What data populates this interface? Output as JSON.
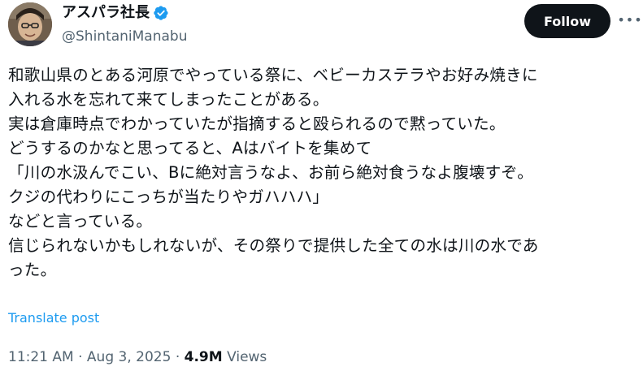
{
  "author": {
    "display_name": "アスパラ社長",
    "handle": "@ShintaniManabu",
    "verified": true
  },
  "actions": {
    "follow_label": "Follow"
  },
  "tweet": {
    "lines": [
      "和歌山県のとある河原でやっている祭に、ベビーカステラやお好み焼きに",
      "入れる水を忘れて来てしまったことがある。",
      "実は倉庫時点でわかっていたが指摘すると殴られるので黙っていた。",
      "どうするのかなと思ってると、Aはバイトを集めて",
      "「川の水汲んでこい、Bに絶対言うなよ、お前ら絶対食うなよ腹壊すぞ。",
      "クジの代わりにこっちが当たりやガハハハ」",
      "などと言っている。",
      "信じられないかもしれないが、その祭りで提供した全ての水は川の水であ",
      "った。"
    ],
    "translate_label": "Translate post"
  },
  "meta": {
    "time": "11:21 AM",
    "separator": " · ",
    "date": "Aug 3, 2025",
    "views_count": "4.9M",
    "views_label": " Views"
  },
  "colors": {
    "text": "#0f1419",
    "secondary": "#536471",
    "link": "#1d9bf0",
    "verified": "#1d9bf0",
    "button_bg": "#0f1419"
  },
  "icons": {
    "verified": "verified-badge-icon",
    "more": "more-horizontal-icon"
  }
}
